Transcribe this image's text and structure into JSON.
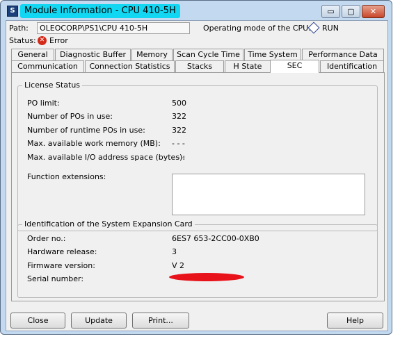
{
  "window": {
    "title": "Module Information - CPU 410-5H",
    "controls": {
      "minimize": "▭",
      "maximize": "▢",
      "close": "✕"
    }
  },
  "header": {
    "path_label": "Path:",
    "path_value": "OLEOCORP\\PS1\\CPU 410-5H",
    "status_label": "Status:",
    "status_value": "Error",
    "opmode_label": "Operating mode of the  CPU:",
    "opmode_value": "RUN"
  },
  "tabs_row1": [
    "General",
    "Diagnostic Buffer",
    "Memory",
    "Scan Cycle Time",
    "Time System",
    "Performance Data"
  ],
  "tabs_row2": [
    "Communication",
    "Connection Statistics",
    "Stacks",
    "H State",
    "SEC",
    "Identification"
  ],
  "active_tab": "SEC",
  "license": {
    "title": "License Status",
    "rows": [
      {
        "label": "PO limit:",
        "value": "500"
      },
      {
        "label": "Number of POs in use:",
        "value": "322"
      },
      {
        "label": "Number of runtime POs in use:",
        "value": "322"
      },
      {
        "label": "Max. available work memory (MB):",
        "value": "- - -"
      },
      {
        "label": "Max. available I/O address space (bytes):",
        "value": "- - -"
      }
    ],
    "function_ext_label": "Function extensions:"
  },
  "sec_card": {
    "title": "Identification of the System Expansion Card",
    "rows": [
      {
        "label": "Order no.:",
        "value": "6ES7 653-2CC00-0XB0"
      },
      {
        "label": "Hardware release:",
        "value": "3"
      },
      {
        "label": "Firmware version:",
        "value": "V 2"
      },
      {
        "label": "Serial number:",
        "value": ""
      }
    ]
  },
  "buttons": {
    "close": "Close",
    "update": "Update",
    "print": "Print...",
    "help": "Help"
  },
  "colors": {
    "title_highlight": "#12d7f2",
    "error": "#d42a1a",
    "redaction": "#e8121a"
  }
}
